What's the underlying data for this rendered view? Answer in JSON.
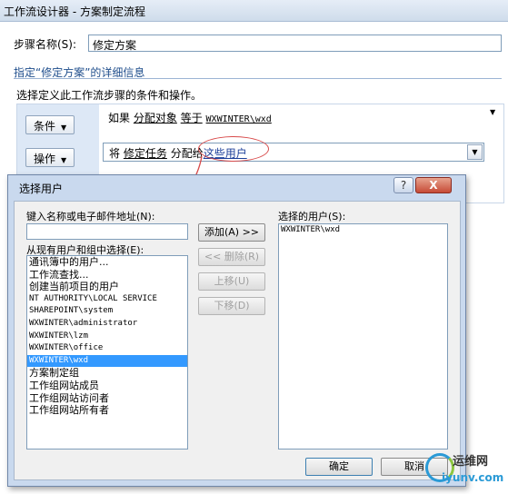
{
  "window": {
    "title": "工作流设计器 - 方案制定流程"
  },
  "step": {
    "name_label": "步骤名称(S):",
    "name_value": "修定方案"
  },
  "detail": {
    "header": "指定“修定方案”的详细信息",
    "instruction": "选择定义此工作流步骤的条件和操作。"
  },
  "rules": {
    "condition_button": "条件",
    "action_button": "操作",
    "condition": {
      "prefix": "如果",
      "field": "分配对象",
      "op": "等于",
      "value": "WXWINTER\\wxd"
    },
    "action": {
      "prefix": "将",
      "task": "修定任务",
      "mid": "分配给",
      "target": "这些用户"
    }
  },
  "dialog": {
    "title": "选择用户",
    "help": "?",
    "close": "X",
    "input_label": "键入名称或电子邮件地址(N):",
    "input_value": "",
    "list_label": "从现有用户和组中选择(E):",
    "available": [
      "通讯簿中的用户...",
      "工作流查找...",
      "创建当前项目的用户",
      "NT AUTHORITY\\LOCAL SERVICE",
      "SHAREPOINT\\system",
      "WXWINTER\\administrator",
      "WXWINTER\\lzm",
      "WXWINTER\\office",
      "WXWINTER\\wxd",
      "方案制定组",
      "工作组网站成员",
      "工作组网站访问者",
      "工作组网站所有者"
    ],
    "selected_label": "选择的用户(S):",
    "selected": [
      "WXWINTER\\wxd"
    ],
    "buttons": {
      "add": "添加(A) >>",
      "remove": "<< 删除(R)",
      "up": "上移(U)",
      "down": "下移(D)",
      "ok": "确定",
      "cancel": "取消"
    }
  },
  "watermark": {
    "line1": "运维网",
    "line2": "iyunv.com"
  }
}
